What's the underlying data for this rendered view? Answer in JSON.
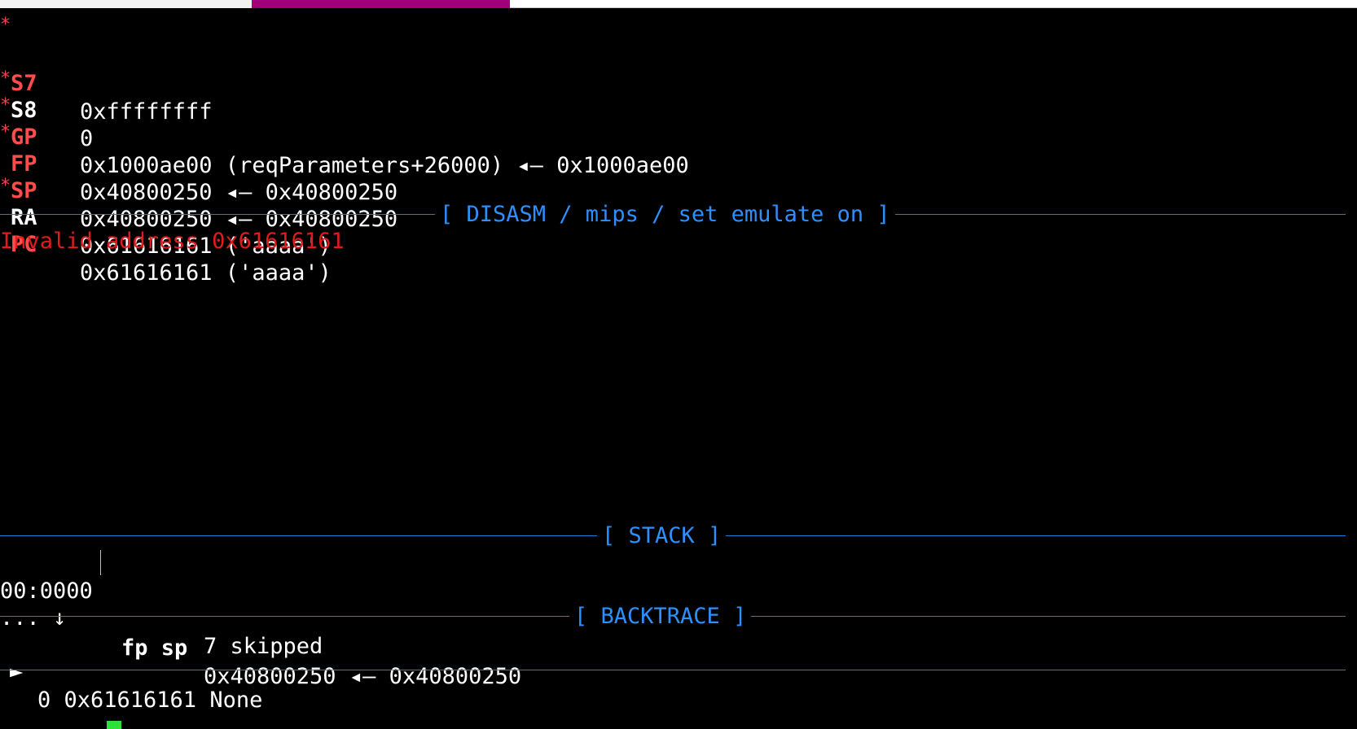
{
  "tabs": [
    {
      "label": "",
      "color": "#f2f2f2"
    },
    {
      "label": "",
      "color": "#a2007a",
      "active": true
    },
    {
      "label": "",
      "color": "#ffffff"
    }
  ],
  "registers": [
    {
      "mark": "*",
      "name": "S7",
      "changed": true,
      "value": "0xffffffff"
    },
    {
      "mark": "",
      "name": "S8",
      "changed": false,
      "value": "0"
    },
    {
      "mark": "*",
      "name": "GP",
      "changed": true,
      "value": "0x1000ae00 (reqParameters+26000) ◂— 0x1000ae00"
    },
    {
      "mark": "*",
      "name": "FP",
      "changed": true,
      "value": "0x40800250 ◂— 0x40800250"
    },
    {
      "mark": "*",
      "name": "SP",
      "changed": true,
      "value": "0x40800250 ◂— 0x40800250"
    },
    {
      "mark": "",
      "name": "RA",
      "changed": false,
      "value": "0x61616161 ('aaaa')"
    },
    {
      "mark": "*",
      "name": "PC",
      "changed": true,
      "value": "0x61616161 ('aaaa')"
    }
  ],
  "disasm": {
    "header": "[ DISASM / mips / set emulate on ]",
    "error": "Invalid address 0x61616161"
  },
  "stack": {
    "header": "[ STACK ]",
    "rows": [
      {
        "offset": "00:0000",
        "regs": "fp sp",
        "value": "0x40800250 ◂— 0x40800250"
      }
    ],
    "skip": {
      "dots": "... ↓",
      "text": "7 skipped"
    }
  },
  "backtrace": {
    "header": "[ BACKTRACE ]",
    "frames": [
      {
        "arrow": "►",
        "text": "0 0x61616161 None"
      }
    ]
  },
  "colors": {
    "background": "#000000",
    "changed_register": "#ff4d4d",
    "header_text": "#2e90ff",
    "rule": "#1f7fd0",
    "error": "#e01b1b",
    "cursor": "#2ee03a"
  }
}
